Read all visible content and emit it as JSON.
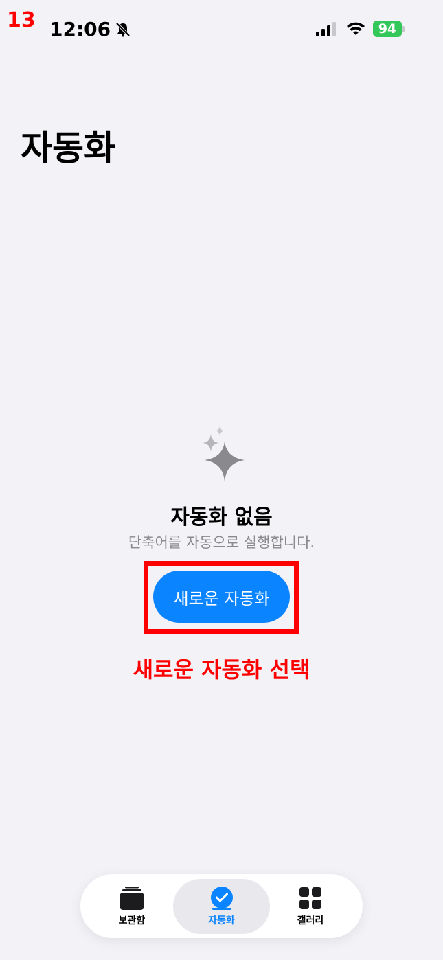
{
  "annotation": {
    "step_number": "13",
    "instruction": "새로운 자동화 선택",
    "color": "#ff0000"
  },
  "status_bar": {
    "time": "12:06",
    "battery_level": "94",
    "icons": [
      "bell-slash-icon",
      "signal-icon",
      "wifi-icon",
      "battery-charging-icon"
    ]
  },
  "header": {
    "title": "자동화"
  },
  "empty_state": {
    "icon": "sparkles-icon",
    "title": "자동화 없음",
    "subtitle": "단축어를 자동으로 실행합니다.",
    "button_label": "새로운 자동화"
  },
  "tab_bar": {
    "items": [
      {
        "label": "보관함",
        "icon": "library-stack-icon",
        "selected": false
      },
      {
        "label": "자동화",
        "icon": "automation-check-icon",
        "selected": true
      },
      {
        "label": "갤러리",
        "icon": "gallery-grid-icon",
        "selected": false
      }
    ]
  },
  "colors": {
    "accent": "#0a84ff",
    "background": "#f2f2f7",
    "battery": "#34c759"
  }
}
